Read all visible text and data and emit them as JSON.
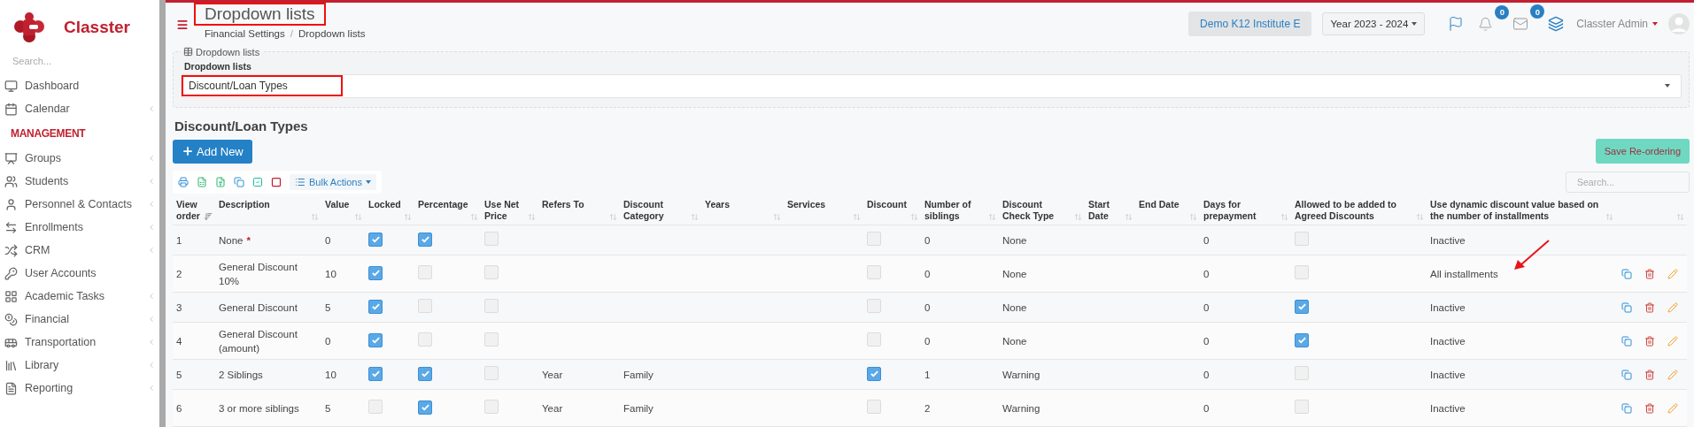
{
  "sidebar": {
    "brand": "Classter",
    "search": {
      "placeholder": "Search..."
    },
    "items": [
      {
        "kind": "link",
        "label": "Dashboard",
        "expandable": false
      },
      {
        "kind": "link",
        "label": "Calendar",
        "expandable": true
      },
      {
        "kind": "heading",
        "label": "MANAGEMENT"
      },
      {
        "kind": "link",
        "label": "Groups",
        "expandable": true
      },
      {
        "kind": "link",
        "label": "Students",
        "expandable": true
      },
      {
        "kind": "link",
        "label": "Personnel & Contacts",
        "expandable": true
      },
      {
        "kind": "link",
        "label": "Enrollments",
        "expandable": true
      },
      {
        "kind": "link",
        "label": "CRM",
        "expandable": true
      },
      {
        "kind": "link",
        "label": "User Accounts",
        "expandable": false
      },
      {
        "kind": "link",
        "label": "Academic Tasks",
        "expandable": true
      },
      {
        "kind": "link",
        "label": "Financial",
        "expandable": true
      },
      {
        "kind": "link",
        "label": "Transportation",
        "expandable": true
      },
      {
        "kind": "link",
        "label": "Library",
        "expandable": true
      },
      {
        "kind": "link",
        "label": "Reporting",
        "expandable": true
      }
    ]
  },
  "header": {
    "title": "Dropdown lists",
    "title_highlighted": true,
    "breadcrumb": {
      "items": [
        "Financial Settings",
        "Dropdown lists"
      ],
      "separator": "/"
    },
    "institute": "Demo K12 Institute E",
    "year": "Year 2023 - 2024",
    "notifications": "0",
    "messages": "0",
    "user": "Classter Admin"
  },
  "panel": {
    "legend": "Dropdown lists",
    "field_label": "Dropdown lists",
    "value": "Discount/Loan Types",
    "highlighted": true
  },
  "table": {
    "title": "Discount/Loan Types",
    "add_button": "Add New",
    "bulk_button": "Bulk Actions",
    "save_button": "Save Re-ordering",
    "save_disabled": true,
    "search": {
      "placeholder": "Search..."
    },
    "columns": [
      {
        "label": "View order",
        "sorted": true
      },
      {
        "label": "Description",
        "sorted": false
      },
      {
        "label": "Value",
        "sorted": false
      },
      {
        "label": "Locked",
        "sorted": false
      },
      {
        "label": "Percentage",
        "sorted": false
      },
      {
        "label": "Use Net Price",
        "sorted": false
      },
      {
        "label": "Refers To",
        "sorted": false
      },
      {
        "label": "Discount Category",
        "sorted": false
      },
      {
        "label": "Years",
        "sorted": false
      },
      {
        "label": "Services",
        "sorted": false
      },
      {
        "label": "Discount",
        "sorted": false
      },
      {
        "label": "Number of siblings",
        "sorted": false
      },
      {
        "label": "Discount Check Type",
        "sorted": false
      },
      {
        "label": "Start Date",
        "sorted": false
      },
      {
        "label": "End Date",
        "sorted": false
      },
      {
        "label": "Days for prepayment",
        "sorted": false
      },
      {
        "label": "Allowed to be added to Agreed Discounts",
        "sorted": false
      },
      {
        "label": "Use dynamic discount value based on the number of installments",
        "sorted": false
      },
      {
        "sorted": false
      }
    ],
    "rows": [
      {
        "order": "1",
        "description": "None",
        "required_mark": "*",
        "value": "0",
        "locked": true,
        "percentage": true,
        "use_net_price": false,
        "discount": false,
        "siblings": "0",
        "check_type": "None",
        "days_prepayment": "0",
        "allowed_agreed": false,
        "dynamic_discount": "Inactive",
        "actions": false,
        "arrow": false
      },
      {
        "order": "2",
        "description": "General Discount 10%",
        "value": "10",
        "locked": true,
        "percentage": false,
        "use_net_price": false,
        "discount": false,
        "siblings": "0",
        "check_type": "None",
        "days_prepayment": "0",
        "allowed_agreed": false,
        "dynamic_discount": "All installments",
        "actions": true,
        "arrow": true
      },
      {
        "order": "3",
        "description": "General Discount",
        "value": "5",
        "locked": true,
        "percentage": false,
        "use_net_price": false,
        "discount": false,
        "siblings": "0",
        "check_type": "None",
        "days_prepayment": "0",
        "allowed_agreed": true,
        "dynamic_discount": "Inactive",
        "actions": true,
        "arrow": false
      },
      {
        "order": "4",
        "description": "General Discount (amount)",
        "value": "0",
        "locked": true,
        "percentage": false,
        "use_net_price": false,
        "discount": false,
        "siblings": "0",
        "check_type": "None",
        "days_prepayment": "0",
        "allowed_agreed": true,
        "dynamic_discount": "Inactive",
        "actions": true,
        "arrow": false
      },
      {
        "order": "5",
        "description": "2 Siblings",
        "value": "10",
        "locked": true,
        "percentage": true,
        "use_net_price": false,
        "refers_to": "Year",
        "discount_category": "Family",
        "discount": true,
        "siblings": "1",
        "check_type": "Warning",
        "days_prepayment": "0",
        "allowed_agreed": false,
        "dynamic_discount": "Inactive",
        "actions": true,
        "arrow": false
      },
      {
        "order": "6",
        "description": "3 or more siblings",
        "value": "5",
        "locked": false,
        "percentage": true,
        "use_net_price": false,
        "refers_to": "Year",
        "discount_category": "Family",
        "discount": false,
        "siblings": "2",
        "check_type": "Warning",
        "days_prepayment": "0",
        "allowed_agreed": false,
        "dynamic_discount": "Inactive",
        "actions": true,
        "arrow": false
      }
    ]
  }
}
